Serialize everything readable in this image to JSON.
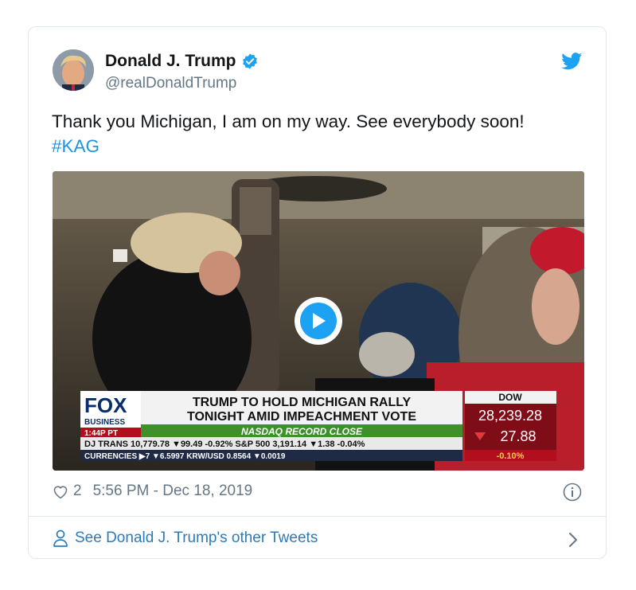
{
  "author": {
    "name": "Donald J. Trump",
    "handle": "@realDonaldTrump"
  },
  "tweet": {
    "text": "Thank you Michigan, I am on my way. See everybody soon!",
    "hashtag": "#KAG"
  },
  "video": {
    "network": "FOX",
    "network_sub": "BUSINESS",
    "time": "1:44P PT",
    "headline_line1": "TRUMP TO HOLD MICHIGAN RALLY",
    "headline_line2": "TONIGHT AMID IMPEACHMENT VOTE",
    "subhead": "NASDAQ RECORD CLOSE",
    "ticker_row1": "DJ TRANS 10,779.78 ▼99.49 -0.92% S&P 500  3,191.14 ▼1.38 -0.04%",
    "ticker_row2": "CURRENCIES ▶7 ▼6.5997 KRW/USD 0.8564 ▼0.0019",
    "dow_label": "DOW",
    "dow_value": "28,239.28",
    "dow_change": "27.88",
    "dow_pct": "-0.10%"
  },
  "meta": {
    "likes": "2",
    "timestamp": "5:56 PM - Dec 18, 2019"
  },
  "footer": {
    "other_tweets": "See Donald J. Trump's other Tweets"
  },
  "colors": {
    "accent": "#1da1f2",
    "link": "#1b95e0",
    "muted": "#657786"
  }
}
